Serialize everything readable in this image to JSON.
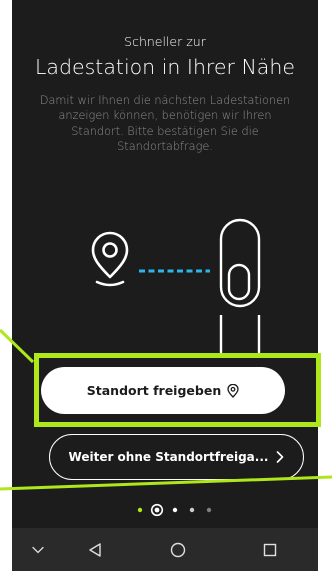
{
  "onboarding": {
    "subtitle": "Schneller zur",
    "headline": "Ladestation in Ihrer Nähe",
    "body_lines": [
      "Damit wir Ihnen die nächsten Ladestationen",
      "anzeigen können, benötigen wir Ihren",
      "Standort. Bitte bestätigen Sie die",
      "Standortabfrage."
    ]
  },
  "buttons": {
    "share_location_label": "Standort freigeben",
    "continue_without_label": "Weiter ohne Standortfreiga..."
  },
  "pager": {
    "total": 5,
    "active_index": 1
  },
  "icons": {
    "share_location": "location-pin-icon",
    "continue": "chevron-right-icon",
    "nav": [
      "chevron-down-icon",
      "back-triangle-icon",
      "home-circle-icon",
      "recents-square-icon"
    ]
  },
  "colors": {
    "background": "#1c1c1c",
    "accent": "#aee71b",
    "connector_dash": "#2db4e8",
    "body_text": "#8e8e8e",
    "button_bg": "#ffffff"
  }
}
